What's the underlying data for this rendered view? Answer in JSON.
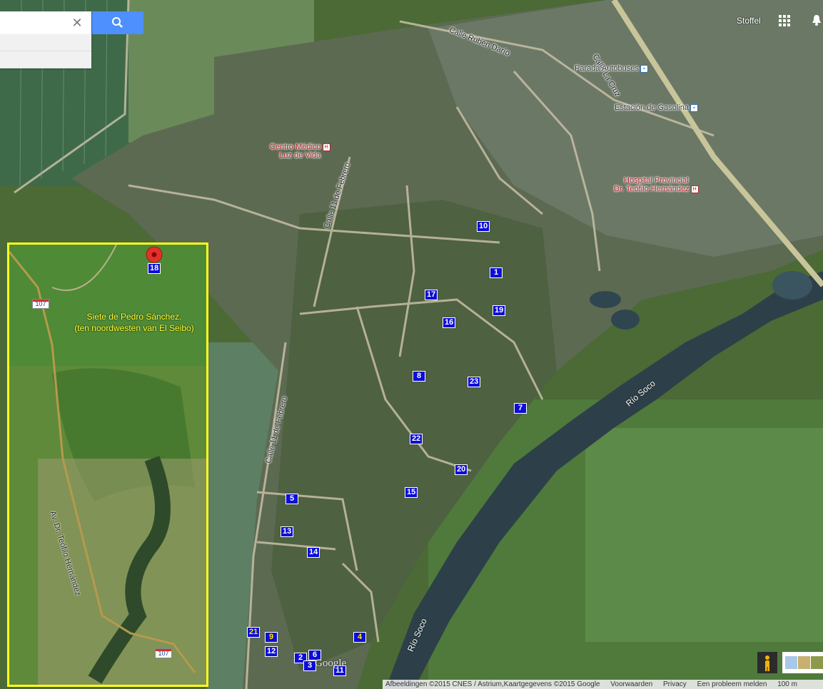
{
  "search": {
    "placeholder": "",
    "value": ""
  },
  "user": {
    "name": "Stoffel"
  },
  "roads": {
    "calle_ruben_dario": "Calle Rubén Darío",
    "calle_la_cruz": "Calle La Cruz",
    "calle_11_febrero_a": "Calle 11 de Febrero",
    "calle_11_febrero_b": "Calle 11 de Febrero",
    "rio_soco_a": "Río Soco",
    "rio_soco_b": "Río Soco"
  },
  "pois": {
    "parada": "Parada Autobuses",
    "gasolina": "Estación de Gasolina",
    "centro_medico_1": "Centro Médico",
    "centro_medico_2": "Luz de Vida",
    "hospital_1": "Hospital Provincial",
    "hospital_2": "Dr. Teófilo Hernández"
  },
  "markers": [
    "10",
    "1",
    "17",
    "19",
    "16",
    "8",
    "23",
    "7",
    "22",
    "20",
    "15",
    "5",
    "13",
    "14",
    "21",
    "9",
    "12",
    "4",
    "2",
    "6",
    "3",
    "11"
  ],
  "inset": {
    "caption_line1": "Siete de Pedro Sánchez.",
    "caption_line2": "(ten noordwesten van El Seibo)",
    "marker": "18",
    "road": "Av. Dr. Teófilo Hernández",
    "shield_top": "107",
    "shield_bottom": "107"
  },
  "google_logo": "Google",
  "footer": {
    "imagery": "Afbeeldingen ©2015 CNES / Astrium,Kaartgegevens ©2015 Google",
    "feedback": "Voorwaarden",
    "privacy": "Privacy",
    "report": "Een probleem melden",
    "scale": "100 m"
  }
}
